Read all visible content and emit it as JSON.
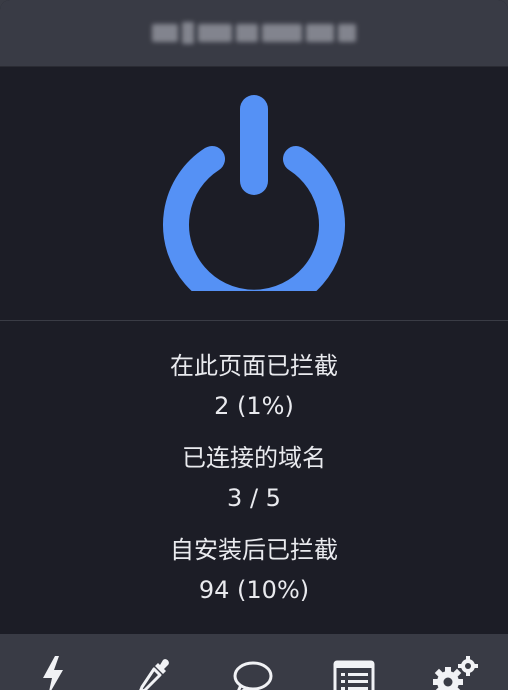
{
  "header": {
    "title_blurred": true
  },
  "power": {
    "state": "on",
    "color": "#5591f5",
    "icon": "power-icon"
  },
  "stats": [
    {
      "label": "在此页面已拦截",
      "value": "2 (1%)"
    },
    {
      "label": "已连接的域名",
      "value": "3 / 5"
    },
    {
      "label": "自安装后已拦截",
      "value": "94 (10%)"
    }
  ],
  "toolbar": {
    "items": [
      {
        "icon": "lightning-icon"
      },
      {
        "icon": "eyedropper-icon"
      },
      {
        "icon": "chat-bubble-icon"
      },
      {
        "icon": "list-icon"
      },
      {
        "icon": "gears-icon"
      }
    ]
  },
  "colors": {
    "background": "#1c1d26",
    "header": "#393b45",
    "accent": "#5591f5",
    "text": "#e9eaee"
  }
}
